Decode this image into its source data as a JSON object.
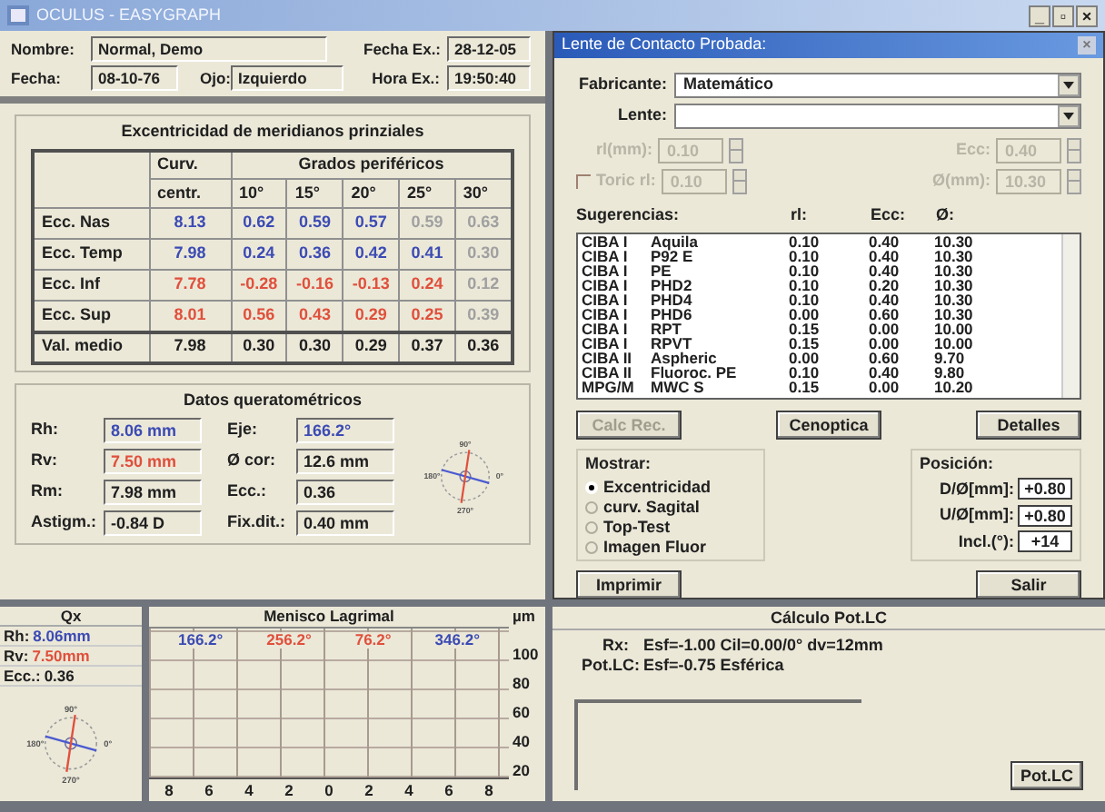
{
  "window": {
    "title": "OCULUS - EASYGRAPH",
    "controls": [
      "_",
      "▫",
      "×"
    ]
  },
  "patient": {
    "fields": [
      {
        "label": "Nombre:",
        "value": "Normal, Demo"
      },
      {
        "label": "Fecha:",
        "value": "08-10-76"
      },
      {
        "label": "Ojo:",
        "value": "Izquierdo"
      },
      {
        "label": "Fecha Ex.:",
        "value": "28-12-05"
      },
      {
        "label": "Hora Ex.:",
        "value": "19:50:40"
      }
    ]
  },
  "eccentricity": {
    "title": "Excentricidad de meridianos prinziales",
    "group_headers": [
      "Curv.",
      "Grados periféricos"
    ],
    "columns": [
      "centr.",
      "10°",
      "15°",
      "20°",
      "25°",
      "30°"
    ],
    "rows": [
      {
        "label": "Ecc. Nas",
        "cells": [
          {
            "text": "8.13",
            "color": "#3c4bb4"
          },
          {
            "text": "0.62",
            "color": "#3c4bb4"
          },
          {
            "text": "0.59",
            "color": "#3c4bb4"
          },
          {
            "text": "0.57",
            "color": "#3c4bb4"
          },
          {
            "text": "0.59",
            "color": "#a0a0a0"
          },
          {
            "text": "0.63",
            "color": "#a0a0a0"
          }
        ]
      },
      {
        "label": "Ecc. Temp",
        "cells": [
          {
            "text": "7.98",
            "color": "#3c4bb4"
          },
          {
            "text": "0.24",
            "color": "#3c4bb4"
          },
          {
            "text": "0.36",
            "color": "#3c4bb4"
          },
          {
            "text": "0.42",
            "color": "#3c4bb4"
          },
          {
            "text": "0.41",
            "color": "#3c4bb4"
          },
          {
            "text": "0.30",
            "color": "#a0a0a0"
          }
        ]
      },
      {
        "label": "Ecc. Inf",
        "cells": [
          {
            "text": "7.78",
            "color": "#e0503c"
          },
          {
            "text": "-0.28",
            "color": "#e0503c"
          },
          {
            "text": "-0.16",
            "color": "#e0503c"
          },
          {
            "text": "-0.13",
            "color": "#e0503c"
          },
          {
            "text": "0.24",
            "color": "#e0503c"
          },
          {
            "text": "0.12",
            "color": "#a0a0a0"
          }
        ]
      },
      {
        "label": "Ecc. Sup",
        "cells": [
          {
            "text": "8.01",
            "color": "#e0503c"
          },
          {
            "text": "0.56",
            "color": "#e0503c"
          },
          {
            "text": "0.43",
            "color": "#e0503c"
          },
          {
            "text": "0.29",
            "color": "#e0503c"
          },
          {
            "text": "0.25",
            "color": "#e0503c"
          },
          {
            "text": "0.39",
            "color": "#a0a0a0"
          }
        ]
      },
      {
        "label": "Val. medio",
        "cells": [
          {
            "text": "7.98",
            "color": "#202020"
          },
          {
            "text": "0.30",
            "color": "#202020"
          },
          {
            "text": "0.30",
            "color": "#202020"
          },
          {
            "text": "0.29",
            "color": "#202020"
          },
          {
            "text": "0.37",
            "color": "#202020"
          },
          {
            "text": "0.36",
            "color": "#202020"
          }
        ]
      }
    ]
  },
  "keratometry": {
    "title": "Datos queratométricos",
    "fields": [
      {
        "label": "Rh:",
        "value": "8.06 mm",
        "color": "#3c4bb4"
      },
      {
        "label": "Eje:",
        "value": "166.2°",
        "color": "#3c4bb4"
      },
      {
        "label": "Rv:",
        "value": "7.50 mm",
        "color": "#e0503c"
      },
      {
        "label": "Ø cor:",
        "value": "12.6 mm",
        "color": "#202020"
      },
      {
        "label": "Rm:",
        "value": "7.98 mm",
        "color": "#202020"
      },
      {
        "label": "Ecc.:",
        "value": "0.36",
        "color": "#202020"
      },
      {
        "label": "Astigm.:",
        "value": "-0.84 D",
        "color": "#202020"
      },
      {
        "label": "Fix.dit.:",
        "value": "0.40 mm",
        "color": "#202020"
      }
    ],
    "compass_labels": [
      "90°",
      "0°",
      "270°",
      "180°"
    ]
  },
  "lens_dialog": {
    "title": "Lente de Contacto Probada:",
    "close": "×",
    "manufacturer": {
      "label": "Fabricante:",
      "value": "Matemático"
    },
    "lens": {
      "label": "Lente:"
    },
    "params": [
      {
        "label": "rl(mm):",
        "value": "0.10",
        "disabled": true
      },
      {
        "label": "Ecc:",
        "value": "0.40",
        "disabled": true
      },
      {
        "label": "Toric rl:",
        "value": "0.10",
        "disabled": true,
        "kind": "checkbox",
        "checked": false
      },
      {
        "label": "Ø(mm):",
        "value": "10.30",
        "disabled": true
      }
    ],
    "list_headers": [
      "Sugerencias:",
      "rl:",
      "Ecc:",
      "Ø:"
    ],
    "suggestions": [
      [
        "CIBA I",
        "Aquila",
        "0.10",
        "0.40",
        "10.30"
      ],
      [
        "CIBA I",
        "P92 E",
        "0.10",
        "0.40",
        "10.30"
      ],
      [
        "CIBA I",
        "PE",
        "0.10",
        "0.40",
        "10.30"
      ],
      [
        "CIBA I",
        "PHD2",
        "0.10",
        "0.20",
        "10.30"
      ],
      [
        "CIBA I",
        "PHD4",
        "0.10",
        "0.40",
        "10.30"
      ],
      [
        "CIBA I",
        "PHD6",
        "0.00",
        "0.60",
        "10.30"
      ],
      [
        "CIBA I",
        "RPT",
        "0.15",
        "0.00",
        "10.00"
      ],
      [
        "CIBA I",
        "RPVT",
        "0.15",
        "0.00",
        "10.00"
      ],
      [
        "CIBA II",
        "Aspheric",
        "0.00",
        "0.60",
        "9.70"
      ],
      [
        "CIBA II",
        "Fluoroc. PE",
        "0.10",
        "0.40",
        "9.80"
      ],
      [
        "MPG/M",
        "MWC S",
        "0.15",
        "0.00",
        "10.20"
      ]
    ],
    "buttons": [
      {
        "label": "Calc Rec.",
        "disabled": true
      },
      {
        "label": "Cenoptica",
        "disabled": false
      },
      {
        "label": "Detalles",
        "disabled": false
      }
    ],
    "show": {
      "title": "Mostrar:",
      "options": [
        {
          "label": "Excentricidad",
          "selected": true
        },
        {
          "label": "curv. Sagital",
          "selected": false
        },
        {
          "label": "Top-Test",
          "selected": false
        },
        {
          "label": "Imagen Fluor",
          "selected": false
        }
      ]
    },
    "position": {
      "title": "Posición:",
      "fields": [
        {
          "label": "D/Ø[mm]:",
          "value": "+0.80"
        },
        {
          "label": "U/Ø[mm]:",
          "value": "+0.80"
        },
        {
          "label": "Incl.(°):",
          "value": "+14"
        }
      ]
    },
    "footer_buttons": [
      "Imprimir",
      "Salir"
    ]
  },
  "qx": {
    "title": "Qx",
    "fields": [
      {
        "label": "Rh:",
        "value": "8.06mm",
        "color": "#3c4bb4"
      },
      {
        "label": "Rv:",
        "value": "7.50mm",
        "color": "#e0503c"
      },
      {
        "label": "Ecc.:",
        "value": "0.36",
        "color": "#202020"
      }
    ],
    "compass_labels": [
      "90°",
      "0°",
      "270°",
      "180°"
    ]
  },
  "meniscus": {
    "title": "Menisco Lagrimal",
    "unit": "µm",
    "axis_labels": [
      {
        "text": "166.2°",
        "color": "#3c4bb4"
      },
      {
        "text": "256.2°",
        "color": "#e0503c"
      },
      {
        "text": "76.2°",
        "color": "#e0503c"
      },
      {
        "text": "346.2°",
        "color": "#3c4bb4"
      }
    ],
    "y_labels": [
      "100",
      "80",
      "60",
      "40",
      "20"
    ],
    "x_labels": [
      "8",
      "6",
      "4",
      "2",
      "0",
      "2",
      "4",
      "6",
      "8"
    ]
  },
  "pot_lc": {
    "title": "Cálculo Pot.LC",
    "lines": [
      {
        "label": "Rx:",
        "value": "Esf=-1.00 Cil=0.00/0° dv=12mm"
      },
      {
        "label": "Pot.LC:",
        "value": "Esf=-0.75 Esférica"
      }
    ],
    "button": "Pot.LC"
  }
}
